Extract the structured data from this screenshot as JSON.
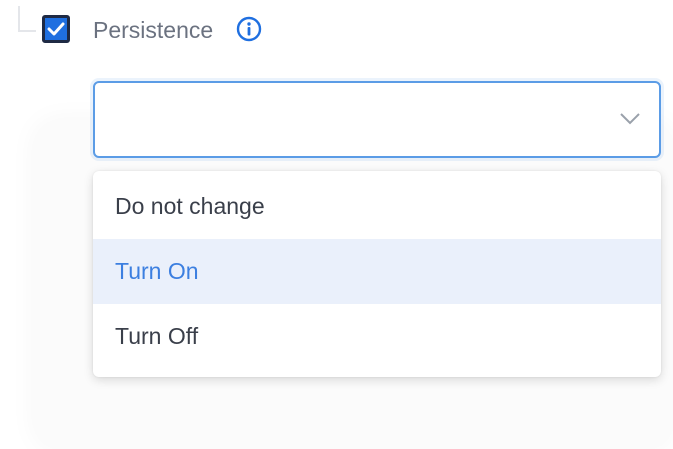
{
  "colors": {
    "accent": "#1f6fe0",
    "focus_border": "#5b9ce6",
    "highlight_bg": "#eaf0fb",
    "highlight_text": "#3c7fe0",
    "label_text": "#6b7280"
  },
  "persistence": {
    "checked": true,
    "checkbox_icon": "check-icon",
    "label": "Persistence",
    "info_icon": "info-circle-icon"
  },
  "select": {
    "value": "",
    "expanded": true,
    "chevron_icon": "chevron-down-icon"
  },
  "dropdown": {
    "highlighted_index": 1,
    "options": [
      {
        "label": "Do not change"
      },
      {
        "label": "Turn On"
      },
      {
        "label": "Turn Off"
      }
    ]
  }
}
